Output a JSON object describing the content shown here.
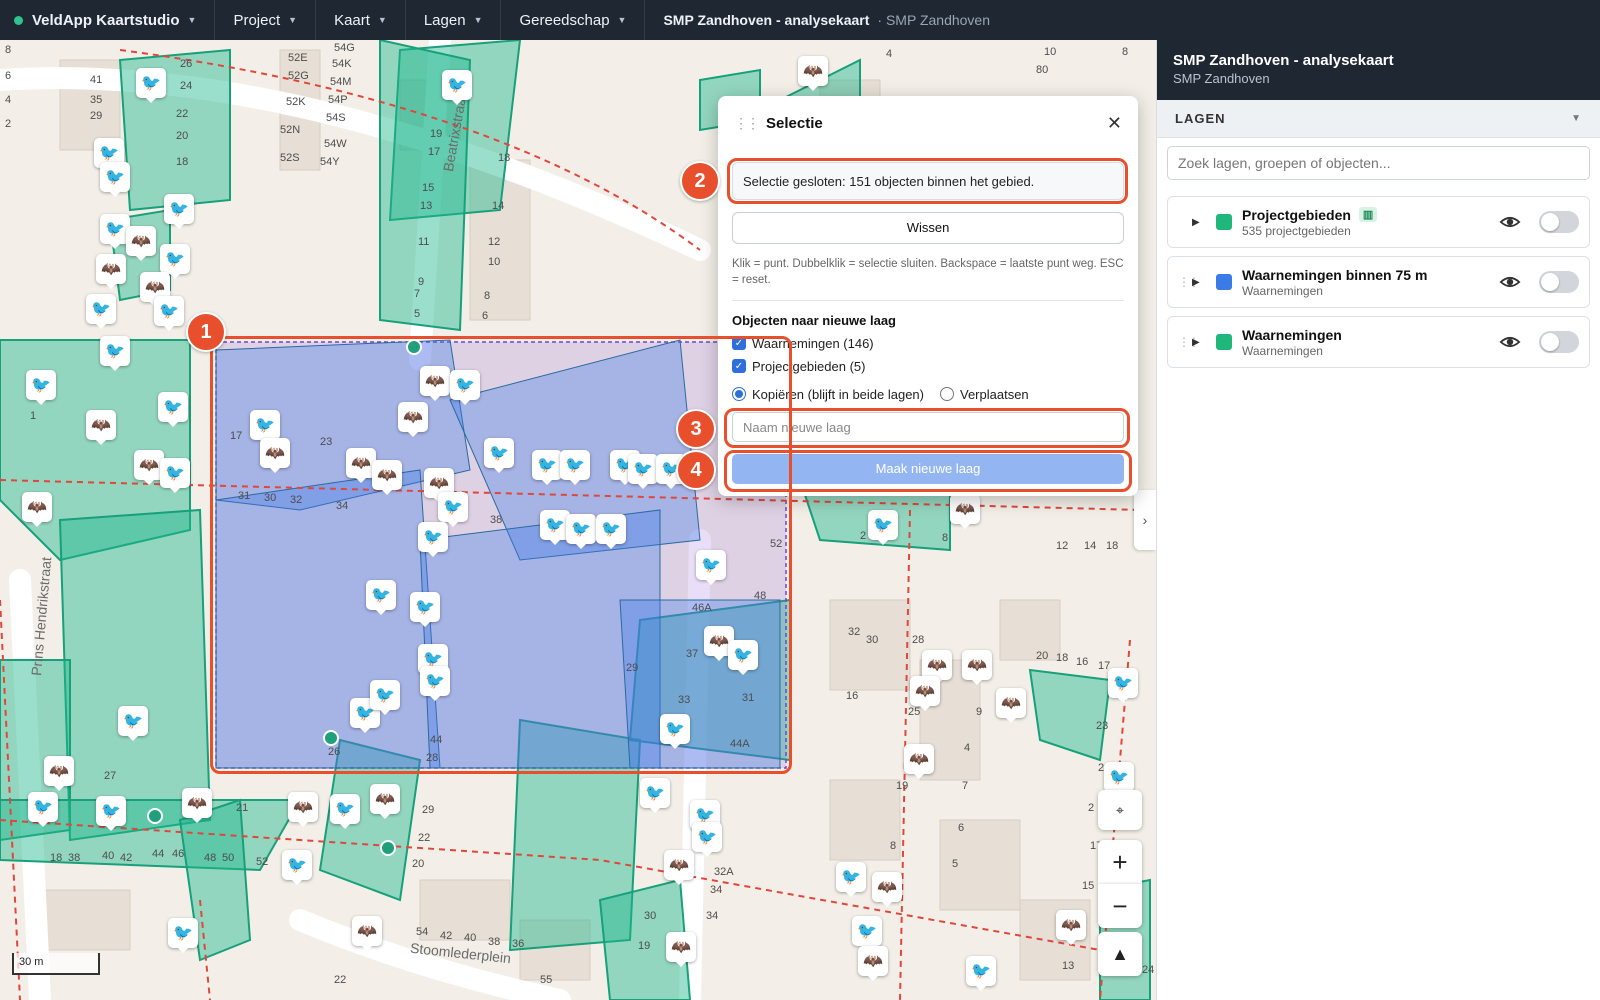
{
  "topbar": {
    "brand": "VeldApp Kaartstudio",
    "menus": [
      "Project",
      "Kaart",
      "Lagen",
      "Gereedschap"
    ],
    "title": "SMP Zandhoven - analysekaart",
    "subtitle": "SMP Zandhoven"
  },
  "map": {
    "streets": [
      "Beatrixstraat",
      "Prins Hendrikstraat",
      "Stoomlederplein"
    ],
    "house_numbers": [
      "8",
      "6",
      "4",
      "2",
      "41",
      "35",
      "29",
      "26",
      "24",
      "22",
      "20",
      "18",
      "52E",
      "52G",
      "52K",
      "52N",
      "52S",
      "54G",
      "54K",
      "54M",
      "54P",
      "54S",
      "54W",
      "54Y",
      "19",
      "17",
      "15",
      "13",
      "11",
      "9",
      "7",
      "5",
      "18",
      "14",
      "12",
      "10",
      "8",
      "6",
      "4",
      "80",
      "10",
      "8",
      "1",
      "17",
      "23",
      "31",
      "30",
      "32",
      "34",
      "38",
      "52",
      "48",
      "46A",
      "37",
      "33",
      "29",
      "31",
      "44A",
      "44",
      "28",
      "26",
      "27",
      "21",
      "29",
      "22",
      "20",
      "18",
      "38",
      "40",
      "42",
      "44",
      "46",
      "48",
      "50",
      "52",
      "54",
      "42",
      "40",
      "38",
      "36",
      "34",
      "30",
      "19",
      "17",
      "16",
      "18",
      "14",
      "12",
      "2",
      "4",
      "8",
      "32",
      "30",
      "28",
      "20",
      "18",
      "16",
      "25",
      "9",
      "23",
      "21",
      "19",
      "7",
      "6",
      "4",
      "8",
      "5",
      "2",
      "17",
      "15",
      "13",
      "24",
      "22",
      "55",
      "32A",
      "34",
      "32"
    ],
    "scale_label": "30 m"
  },
  "selection_popup": {
    "title": "Selectie",
    "status": "Selectie gesloten: 151 objecten binnen het gebied.",
    "clear_button": "Wissen",
    "hint": "Klik = punt. Dubbelklik = selectie sluiten. Backspace = laatste punt weg. ESC = reset.",
    "section_title": "Objecten naar nieuwe laag",
    "checkboxes": [
      {
        "label": "Waarnemingen (146)",
        "checked": true
      },
      {
        "label": "Projectgebieden (5)",
        "checked": true
      }
    ],
    "mode_options": [
      {
        "label": "Kopiëren (blijft in beide lagen)",
        "selected": true
      },
      {
        "label": "Verplaatsen",
        "selected": false
      }
    ],
    "new_layer_placeholder": "Naam nieuwe laag",
    "create_button": "Maak nieuwe laag"
  },
  "callouts": [
    "1",
    "2",
    "3",
    "4"
  ],
  "panel": {
    "title": "SMP Zandhoven - analysekaart",
    "subtitle": "SMP Zandhoven",
    "section": "LAGEN",
    "search_placeholder": "Zoek lagen, groepen of objecten...",
    "layers": [
      {
        "name": "Projectgebieden",
        "sub": "535 projectgebieden",
        "color": "#1fb77c",
        "tag": "map-icon",
        "visible": false
      },
      {
        "name": "Waarnemingen binnen 75 m",
        "sub": "Waarnemingen",
        "color": "#3b7be8",
        "visible": false
      },
      {
        "name": "Waarnemingen",
        "sub": "Waarnemingen",
        "color": "#1fb77c",
        "visible": false
      }
    ]
  },
  "colors": {
    "accent": "#e8502d",
    "topbar": "#1f2733",
    "project_area": "#1fb98f",
    "selection": "#8a5cd8",
    "button_primary": "#93b6f2"
  }
}
